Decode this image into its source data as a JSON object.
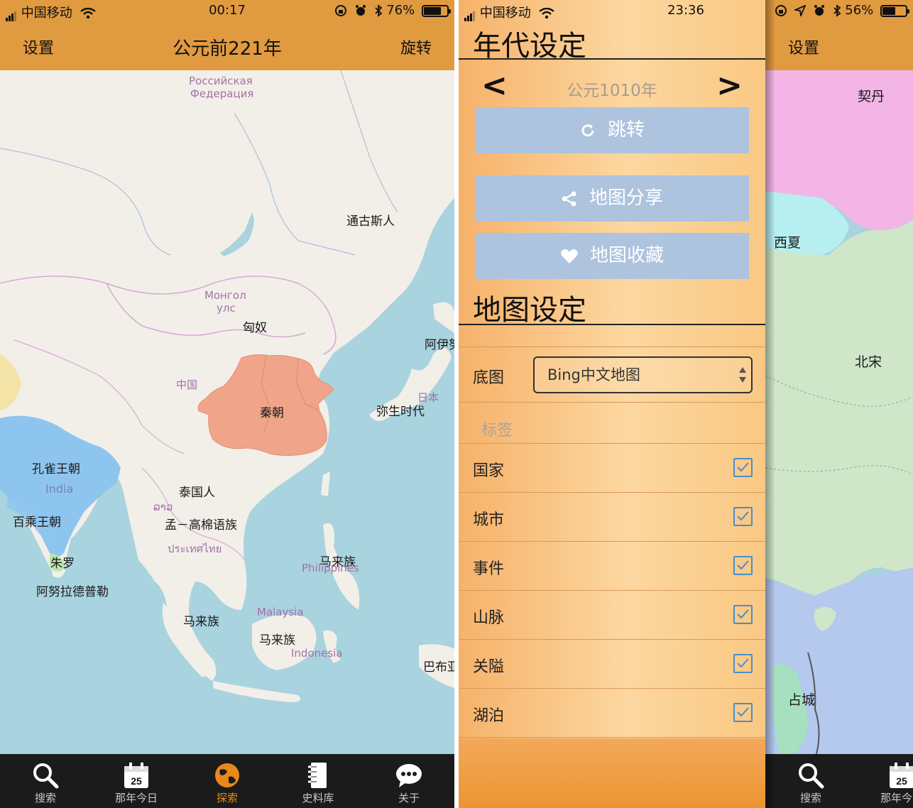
{
  "left_screen": {
    "status": {
      "carrier": "中国移动",
      "time": "00:17",
      "battery": "76%",
      "battery_level": 0.76
    },
    "nav": {
      "left_button": "设置",
      "title": "公元前221年",
      "right_button": "旋转"
    },
    "map_labels": {
      "russia": "Российская Федерация",
      "russia_line1": "Российская",
      "russia_line2": "Федерация",
      "tonggusi": "通古斯人",
      "mongol_line1": "Монгол",
      "mongol_line2": "улс",
      "xiongnu": "匈奴",
      "ayi": "阿伊努",
      "zhongguo": "中国",
      "qin": "秦朝",
      "riben": "日本",
      "yayoi": "弥生时代",
      "kongque": "孔雀王朝",
      "india": "India",
      "baicheng": "百乘王朝",
      "taiguoren": "泰国人",
      "laos": "ລາວ",
      "menggaomian": "孟－高棉语族",
      "thai": "ประเทศไทย",
      "malaizu_ph": "马来族",
      "philippines": "Philippines",
      "zhuluo": "朱罗",
      "anuradhapura": "阿努拉德普勒",
      "malaizu1": "马来族",
      "malaysia": "Malaysia",
      "malaizu2": "马来族",
      "indonesia": "Indonesia",
      "babuya": "巴布亚"
    },
    "tabs": [
      {
        "label": "搜索",
        "icon": "search-icon"
      },
      {
        "label": "那年今日",
        "icon": "calendar-icon",
        "badge": "25"
      },
      {
        "label": "探索",
        "icon": "globe-icon",
        "active": true
      },
      {
        "label": "史料库",
        "icon": "book-icon"
      },
      {
        "label": "关于",
        "icon": "chat-icon"
      }
    ]
  },
  "right_screen": {
    "status": {
      "carrier": "中国移动",
      "time": "23:36",
      "battery": "56%",
      "battery_level": 0.56
    },
    "era_settings": {
      "title": "年代设定",
      "prev": "<",
      "next": ">",
      "year": "公元1010年",
      "jump_button": "跳转",
      "share_button": "地图分享",
      "favorite_button": "地图收藏"
    },
    "map_settings": {
      "title": "地图设定",
      "basemap_label": "底图",
      "basemap_value": "Bing中文地图",
      "tags_header": "标签",
      "options": [
        {
          "label": "国家",
          "checked": true
        },
        {
          "label": "城市",
          "checked": true
        },
        {
          "label": "事件",
          "checked": true
        },
        {
          "label": "山脉",
          "checked": true
        },
        {
          "label": "关隘",
          "checked": true
        },
        {
          "label": "湖泊",
          "checked": true
        }
      ]
    },
    "behind": {
      "nav_left_button": "设置",
      "labels": {
        "qidan": "契丹",
        "xixia": "西夏",
        "beisong": "北宋",
        "zhancheng": "占城"
      },
      "tabs": [
        {
          "label": "搜索",
          "icon": "search-icon"
        },
        {
          "label": "那年今日",
          "icon": "calendar-icon",
          "badge": "25"
        }
      ]
    }
  },
  "colors": {
    "nav_orange": "#e09a40",
    "qin_fill": "#f0a58a",
    "india_fill": "#8ec5ef",
    "sea": "#a9d3de",
    "land": "#f2efe9",
    "button_blue": "#adc3de",
    "checkbox_blue": "#4a8ec8",
    "active_tab": "#e88a1a"
  }
}
